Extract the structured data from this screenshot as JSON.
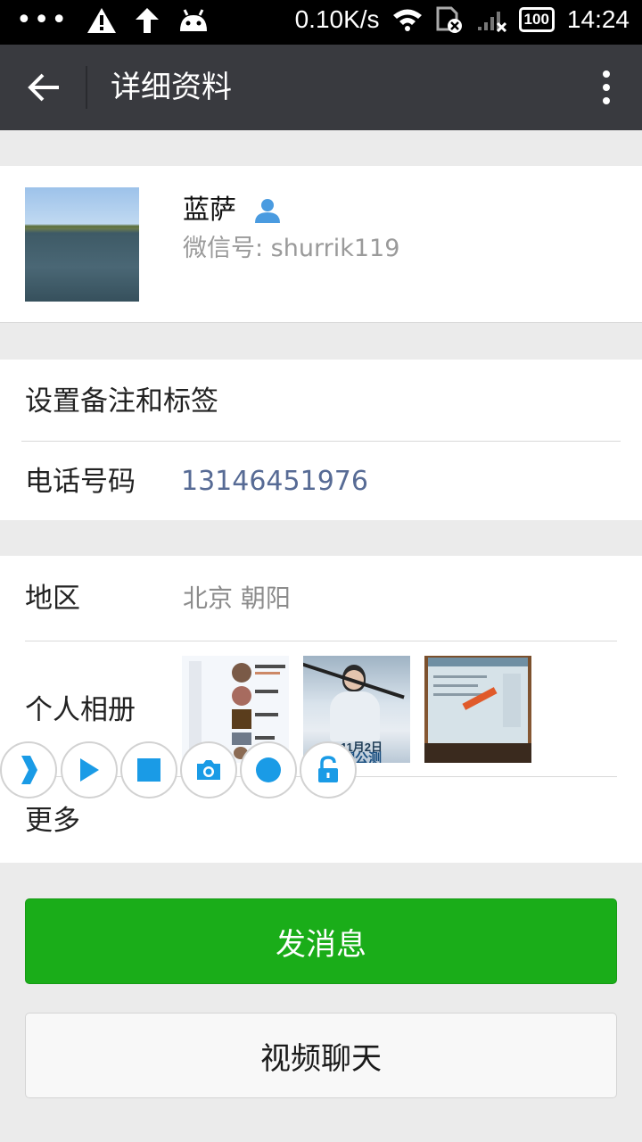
{
  "status_bar": {
    "dots": "•••",
    "network_speed": "0.10K/s",
    "battery": "100",
    "time": "14:24"
  },
  "app_bar": {
    "title": "详细资料"
  },
  "profile": {
    "name": "蓝萨",
    "wechat_id": "微信号: shurrik119"
  },
  "rows": {
    "remark_label": "设置备注和标签",
    "phone_label": "电话号码",
    "phone_value": "13146451976",
    "region_label": "地区",
    "region_value": "北京  朝阳",
    "album_label": "个人相册",
    "more_label": "更多"
  },
  "album_photos": {
    "photo2_caption": "11月2日",
    "photo2_caption2": "荣耀公测"
  },
  "buttons": {
    "send_message": "发消息",
    "video_chat": "视频聊天"
  },
  "colors": {
    "accent_green": "#1aad19",
    "link_blue": "#576b95",
    "toolbar_blue": "#1a9be6"
  }
}
